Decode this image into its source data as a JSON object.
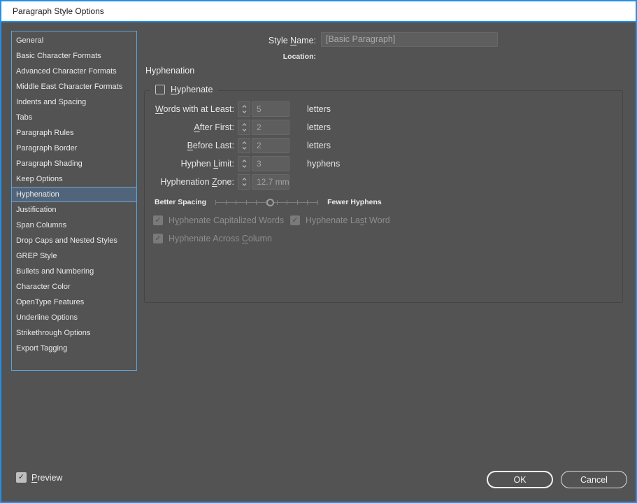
{
  "window": {
    "title": "Paragraph Style Options"
  },
  "sidebar": {
    "items": [
      "General",
      "Basic Character Formats",
      "Advanced Character Formats",
      "Middle East Character Formats",
      "Indents and Spacing",
      "Tabs",
      "Paragraph Rules",
      "Paragraph Border",
      "Paragraph Shading",
      "Keep Options",
      "Hyphenation",
      "Justification",
      "Span Columns",
      "Drop Caps and Nested Styles",
      "GREP Style",
      "Bullets and Numbering",
      "Character Color",
      "OpenType Features",
      "Underline Options",
      "Strikethrough Options",
      "Export Tagging"
    ],
    "selected": "Hyphenation",
    "selected_index": 10
  },
  "header": {
    "style_name_label": {
      "text": "Style Name:",
      "u": 6
    },
    "style_name_value": "[Basic Paragraph]",
    "location_label": "Location:",
    "location_value": ""
  },
  "panel": {
    "title": "Hyphenation"
  },
  "hyphenation": {
    "hyphenate": {
      "label": {
        "text": "Hyphenate",
        "u": 0
      },
      "checked": false
    },
    "fields": [
      {
        "label": {
          "text": "Words with at Least:",
          "u": 0
        },
        "value": "5",
        "suffix": "letters"
      },
      {
        "label": {
          "text": "After First:",
          "u": 0
        },
        "value": "2",
        "suffix": "letters"
      },
      {
        "label": {
          "text": "Before Last:",
          "u": 0
        },
        "value": "2",
        "suffix": "letters"
      },
      {
        "label": {
          "text": "Hyphen Limit:",
          "u": 7
        },
        "value": "3",
        "suffix": "hyphens"
      },
      {
        "label": {
          "text": "Hyphenation Zone:",
          "u": 12
        },
        "value": "12.7 mm",
        "suffix": ""
      }
    ],
    "slider": {
      "left_label": "Better Spacing",
      "right_label": "Fewer Hyphens",
      "position_pct": 53,
      "tick_count": 11
    },
    "options": [
      {
        "label": {
          "text": "Hyphenate Capitalized Words",
          "u": 1
        },
        "checked": true,
        "disabled": true
      },
      {
        "label": {
          "text": "Hyphenate Last Word",
          "u": 12
        },
        "checked": true,
        "disabled": true
      },
      {
        "label": {
          "text": "Hyphenate Across Column",
          "u": 17
        },
        "checked": true,
        "disabled": true
      }
    ]
  },
  "footer": {
    "preview": {
      "label": {
        "text": "Preview",
        "u": 0
      },
      "checked": true
    },
    "ok_label": "OK",
    "cancel_label": "Cancel"
  },
  "colors": {
    "window_border": "#2191e9",
    "titlebar_bg": "#ffffff",
    "dialog_bg": "#535353",
    "sidebar_border": "#5ba4da",
    "selected_item_bg": "#50657b",
    "field_bg": "#5e5e5e",
    "disabled_text": "#9a9a9a",
    "text": "#e9e9e9"
  },
  "icons": {
    "check": "✓"
  }
}
